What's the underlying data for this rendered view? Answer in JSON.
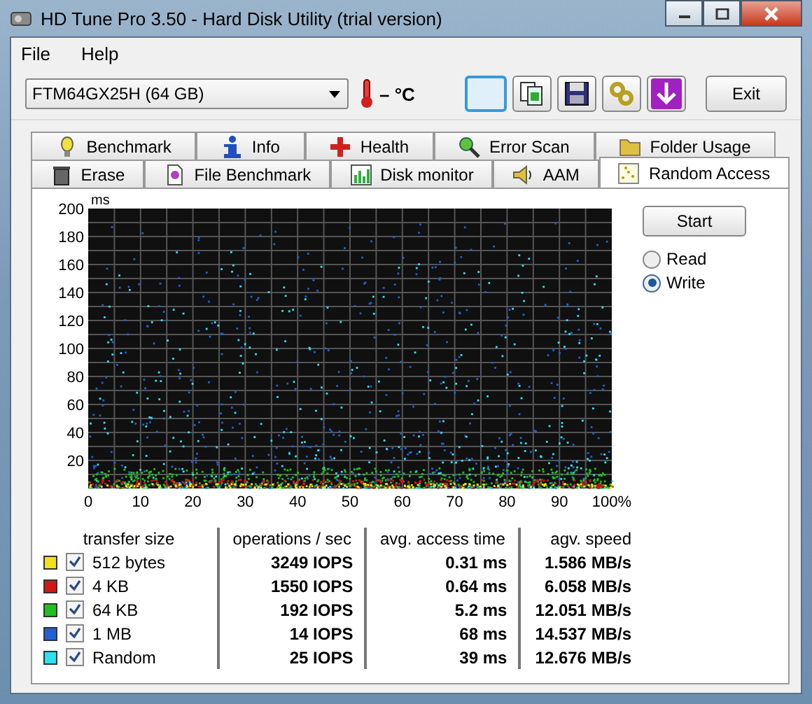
{
  "window": {
    "title": "HD Tune Pro 3.50 - Hard Disk Utility (trial version)"
  },
  "menu": [
    "File",
    "Help"
  ],
  "drive": {
    "value": "FTM64GX25H (64 GB)"
  },
  "temperature": "– °C",
  "toolbar": [
    {
      "kind": "blank",
      "selected": true
    },
    {
      "kind": "copy",
      "selected": false
    },
    {
      "kind": "save",
      "selected": false
    },
    {
      "kind": "chain",
      "selected": false
    },
    {
      "kind": "download",
      "selected": false
    }
  ],
  "exit_button": "Exit",
  "tabs_row_1": [
    {
      "label": "Benchmark",
      "selected": false
    },
    {
      "label": "Info",
      "selected": false
    },
    {
      "label": "Health",
      "selected": false
    },
    {
      "label": "Error Scan",
      "selected": false
    },
    {
      "label": "Folder Usage",
      "selected": false
    }
  ],
  "tabs_row_2": [
    {
      "label": "Erase",
      "selected": false
    },
    {
      "label": "File Benchmark",
      "selected": false
    },
    {
      "label": "Disk monitor",
      "selected": false
    },
    {
      "label": "AAM",
      "selected": false
    },
    {
      "label": "Random Access",
      "selected": true
    }
  ],
  "chart": {
    "ylabel": "ms",
    "yticks": [
      "200",
      "180",
      "160",
      "140",
      "120",
      "100",
      "80",
      "60",
      "40",
      "20"
    ],
    "xticks": [
      "0",
      "10",
      "20",
      "30",
      "40",
      "50",
      "60",
      "70",
      "80",
      "90",
      "100%"
    ]
  },
  "start_button": "Start",
  "mode": [
    {
      "label": "Read",
      "selected": false
    },
    {
      "label": "Write",
      "selected": true
    }
  ],
  "table": {
    "columns": [
      "transfer size",
      "operations / sec",
      "avg. access time",
      "agv. speed"
    ],
    "rows": [
      {
        "color": "#f0e020",
        "checked": true,
        "size": "512 bytes",
        "ops": "3249 IOPS",
        "time": "0.31 ms",
        "speed": "1.586 MB/s"
      },
      {
        "color": "#d01818",
        "checked": true,
        "size": "4 KB",
        "ops": "1550 IOPS",
        "time": "0.64 ms",
        "speed": "6.058 MB/s"
      },
      {
        "color": "#20c020",
        "checked": true,
        "size": "64 KB",
        "ops": "192 IOPS",
        "time": "5.2 ms",
        "speed": "12.051 MB/s"
      },
      {
        "color": "#2060d0",
        "checked": true,
        "size": "1 MB",
        "ops": "14 IOPS",
        "time": "68 ms",
        "speed": "14.537 MB/s"
      },
      {
        "color": "#30e0f0",
        "checked": true,
        "size": "Random",
        "ops": "25 IOPS",
        "time": "39 ms",
        "speed": "12.676 MB/s"
      }
    ]
  }
}
